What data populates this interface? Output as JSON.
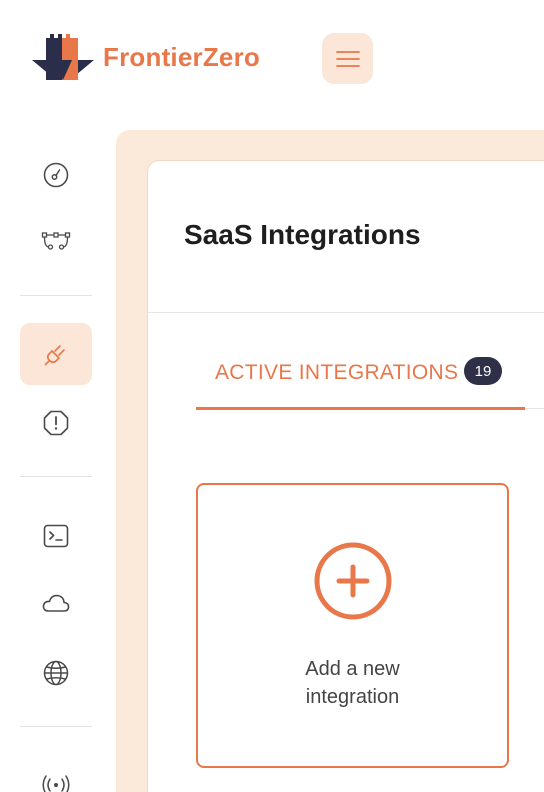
{
  "header": {
    "brand_name": "FrontierZero",
    "menu_icon": "hamburger-icon"
  },
  "sidebar": {
    "items": [
      {
        "icon": "dashboard-gauge-icon",
        "active": false
      },
      {
        "icon": "workflow-nodes-icon",
        "active": false
      },
      {
        "icon": "plug-icon",
        "active": true
      },
      {
        "icon": "alert-octagon-icon",
        "active": false
      },
      {
        "icon": "terminal-icon",
        "active": false
      },
      {
        "icon": "cloud-icon",
        "active": false
      },
      {
        "icon": "globe-icon",
        "active": false
      },
      {
        "icon": "broadcast-icon",
        "active": false
      }
    ]
  },
  "main": {
    "title": "SaaS Integrations",
    "tabs": [
      {
        "label": "ACTIVE INTEGRATIONS",
        "count": "19",
        "active": true
      }
    ],
    "add_card": {
      "line1": "Add a new",
      "line2": "integration",
      "icon": "plus-circle-icon"
    }
  },
  "colors": {
    "accent": "#e8774a",
    "accent_light": "#fbe6d8",
    "badge_bg": "#2e3048",
    "text_dark": "#1e1e1e",
    "icon_gray": "#4a4a4a"
  }
}
